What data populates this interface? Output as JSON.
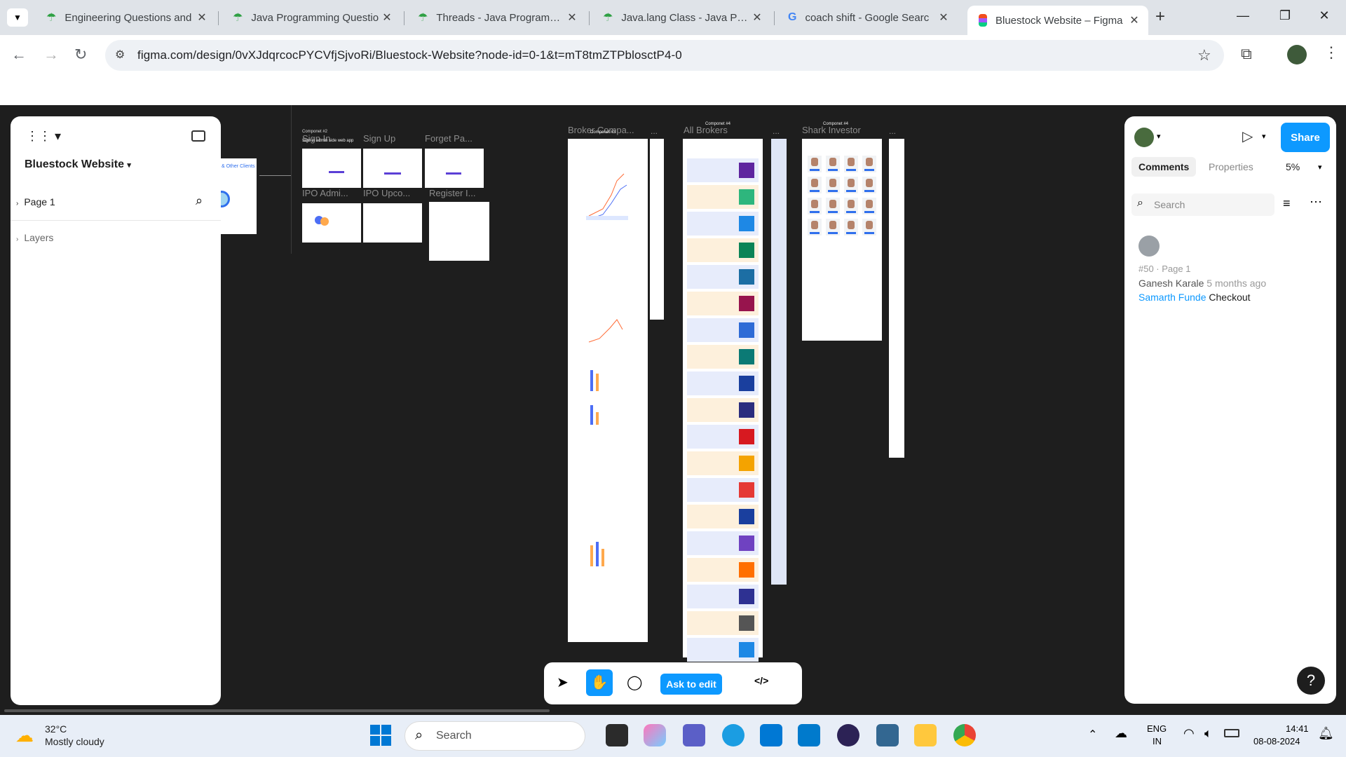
{
  "browser": {
    "tabs": [
      {
        "title": "Engineering Questions and",
        "icon": "umbrella-icon",
        "active": false
      },
      {
        "title": "Java Programming Questio",
        "icon": "umbrella-icon",
        "active": false
      },
      {
        "title": "Threads - Java Programmin",
        "icon": "umbrella-icon",
        "active": false
      },
      {
        "title": "Java.lang Class - Java Prog",
        "icon": "umbrella-icon",
        "active": false
      },
      {
        "title": "coach shift - Google Searc",
        "icon": "google-icon",
        "active": false
      },
      {
        "title": "Bluestock Website – Figma",
        "icon": "figma-icon",
        "active": true
      }
    ],
    "url": "figma.com/design/0vXJdqrcocPYCVfjSjvoRi/Bluestock-Website?node-id=0-1&t=mT8tmZTPblosctP4-0"
  },
  "figma": {
    "file_name": "Bluestock Website",
    "page": "Page 1",
    "layers_label": "Layers",
    "canvas_labels": {
      "sign_in": "Sign In",
      "sign_up": "Sign Up",
      "forget_password": "Forget Pa...",
      "ipo_admin": "IPO Admi...",
      "ipo_upcoming": "IPO Upco...",
      "register": "Register I...",
      "broker_compare": "Broker Compa...",
      "all_brokers": "All Brokers",
      "shark_investor": "Shark Investor",
      "component2": "Componet #2",
      "component3": "Componet #3",
      "component4a": "Componet #4",
      "component4b": "Componet #4",
      "web_app_note": "Sign in admin side web app",
      "clients_label": "& Other Clients"
    },
    "right_panel": {
      "tabs": [
        "Comments",
        "Properties"
      ],
      "active_tab": "Comments",
      "zoom": "5%",
      "share_label": "Share",
      "search_placeholder": "Search",
      "comment": {
        "meta": "#50 · Page 1",
        "author": "Ganesh Karale",
        "time": "5 months ago",
        "mention": "Samarth Funde",
        "text": "Checkout"
      }
    },
    "bottom_toolbar": {
      "ask_to_edit": "Ask to edit"
    },
    "help": "?"
  },
  "taskbar": {
    "weather_temp": "32°C",
    "weather_desc": "Mostly cloudy",
    "search_placeholder": "Search",
    "lang_line1": "ENG",
    "lang_line2": "IN",
    "time": "14:41",
    "date": "08-08-2024"
  },
  "colors": {
    "figma_blue": "#0d99ff",
    "canvas_bg": "#1e1e1e"
  }
}
